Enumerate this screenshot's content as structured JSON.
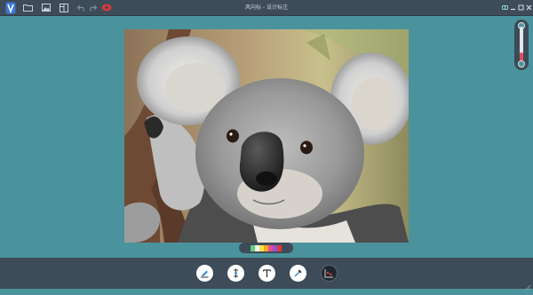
{
  "window": {
    "title": "风向标 - 设计标注"
  },
  "titlebar": {
    "left_icons": [
      "app-logo-icon",
      "open-folder-icon",
      "image-icon",
      "layout-icon",
      "undo-icon",
      "redo-icon",
      "eye-icon"
    ],
    "right_icons": [
      "settings-icon",
      "minimize-icon",
      "maximize-icon",
      "close-icon"
    ]
  },
  "canvas": {
    "image_subject": "koala-photo"
  },
  "zoom": {
    "level_fraction": 0.3
  },
  "palette": {
    "colors": [
      "#5ed07a",
      "#f2f2f2",
      "#f5e23a",
      "#f3a72d",
      "#e84e8a",
      "#9a4fcf",
      "#e0393b"
    ]
  },
  "toolbar": {
    "tools": [
      "pen-tool-icon",
      "measure-tool-icon",
      "text-tool-icon",
      "color-picker-icon",
      "coordinate-tool-icon"
    ],
    "active_tool": "coordinate-tool-icon"
  },
  "colors": {
    "background": "#4a939c",
    "bar": "#3e4b58",
    "accent_red": "#e05155"
  }
}
